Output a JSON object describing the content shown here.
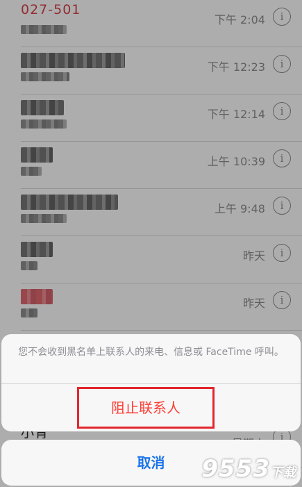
{
  "calls": [
    {
      "name": "027-501",
      "name_style": "red-text",
      "time": "下午 2:04"
    },
    {
      "name": "",
      "time": "下午 12:23"
    },
    {
      "name": "",
      "time": "下午 12:14"
    },
    {
      "name": "",
      "time": "上午 10:39"
    },
    {
      "name": "",
      "time": "上午 9:48"
    },
    {
      "name": "",
      "time": "昨天"
    },
    {
      "name": "",
      "name_style": "red",
      "time": "昨天"
    },
    {
      "name": "小青",
      "time": "星期六"
    }
  ],
  "info_glyph": "i",
  "action_sheet": {
    "message": "您不会收到黑名单上联系人的来电、信息或 FaceTime 呼叫。",
    "block_label": "阻止联系人",
    "cancel_label": "取消"
  },
  "watermark": {
    "main": "9553",
    "small": "下载"
  },
  "colors": {
    "destructive": "#ff3b30",
    "cancel": "#1a73e8",
    "highlight_box": "#e3262d"
  }
}
